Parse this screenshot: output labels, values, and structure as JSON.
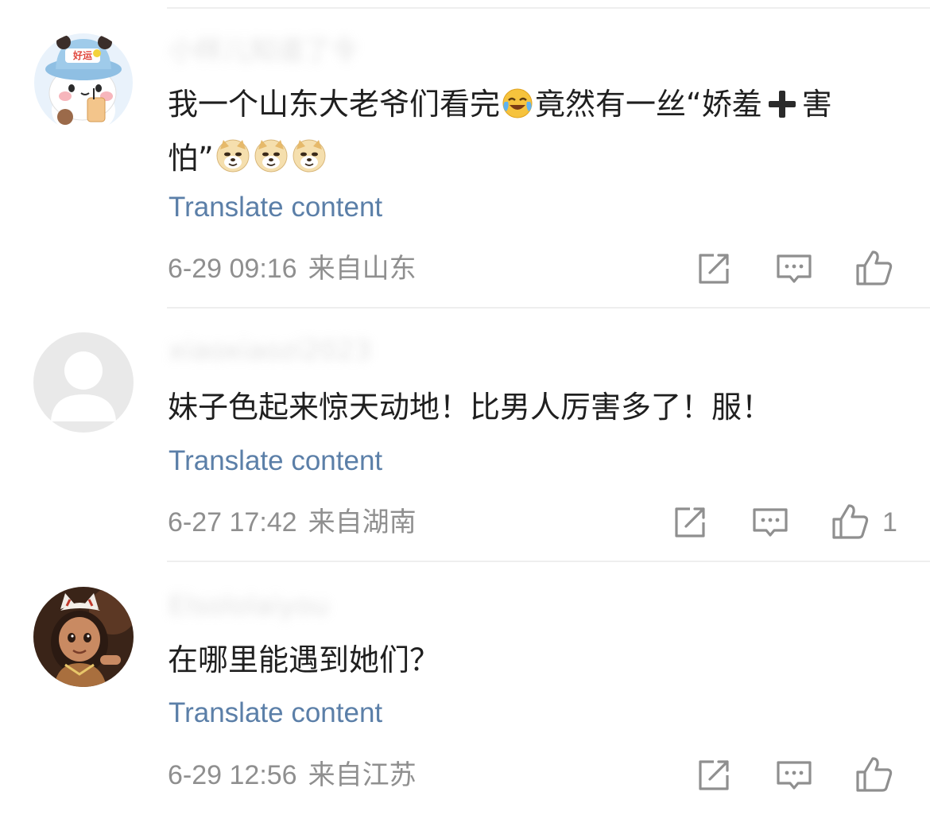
{
  "comments": [
    {
      "avatar": "panda-avatar-with-hat",
      "username": "小样儿知道了令",
      "text_before": "我一个山东大老爷们看完",
      "emoji_laugh_cry": "laughing-crying-emoji",
      "text_middle": "竟然有一丝“娇羞",
      "plus": "plus-emoji",
      "text_after": "害怕”",
      "emoji_doge": "doge-emoji",
      "translate": "Translate content",
      "date": "6-29 09:16",
      "location": "来自山东",
      "likes": ""
    },
    {
      "avatar": "default-gray-avatar",
      "username": "xiaoxiaozi2023",
      "text": "妹子色起来惊天动地！比男人厉害多了！服！",
      "translate": "Translate content",
      "date": "6-27 17:42",
      "location": "来自湖南",
      "likes": "1"
    },
    {
      "avatar": "cartoon-girl-fox-mask-avatar",
      "username": "Elsololaiyou",
      "text": "在哪里能遇到她们？",
      "translate": "Translate content",
      "date": "6-29 12:56",
      "location": "来自江苏",
      "likes": ""
    }
  ],
  "colors": {
    "link": "#5b7fa8",
    "meta": "#8f8f8f",
    "text": "#1f1f1f",
    "divider": "#eeeeee",
    "icon": "#8f8f8f"
  }
}
